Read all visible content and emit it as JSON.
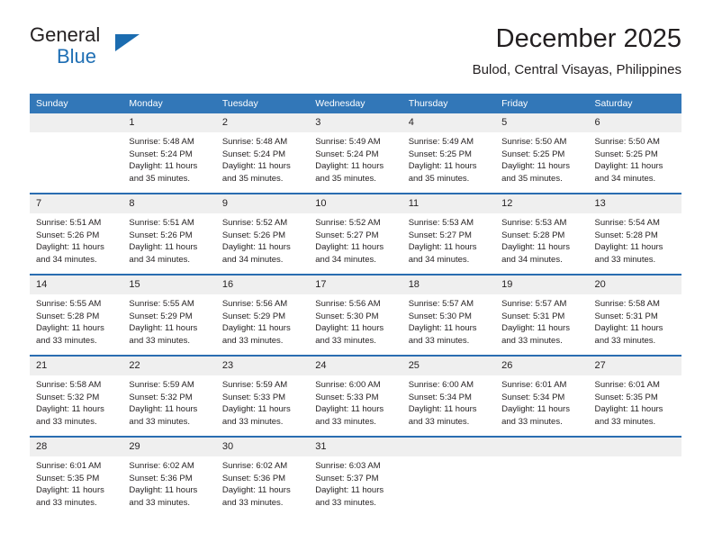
{
  "brand": {
    "name_top": "General",
    "name_bottom": "Blue",
    "accent_color": "#1b6cb0"
  },
  "header": {
    "title": "December 2025",
    "subtitle": "Bulod, Central Visayas, Philippines"
  },
  "calendar": {
    "header_bg": "#3277b8",
    "header_text_color": "#ffffff",
    "daynum_bg": "#efefef",
    "row_divider_color": "#2a6db1",
    "weekday_headers": [
      "Sunday",
      "Monday",
      "Tuesday",
      "Wednesday",
      "Thursday",
      "Friday",
      "Saturday"
    ],
    "weeks": [
      [
        {
          "day": "",
          "sunrise": "",
          "sunset": "",
          "daylight_line1": "",
          "daylight_line2": "",
          "empty": true
        },
        {
          "day": "1",
          "sunrise": "Sunrise: 5:48 AM",
          "sunset": "Sunset: 5:24 PM",
          "daylight_line1": "Daylight: 11 hours",
          "daylight_line2": "and 35 minutes.",
          "empty": false
        },
        {
          "day": "2",
          "sunrise": "Sunrise: 5:48 AM",
          "sunset": "Sunset: 5:24 PM",
          "daylight_line1": "Daylight: 11 hours",
          "daylight_line2": "and 35 minutes.",
          "empty": false
        },
        {
          "day": "3",
          "sunrise": "Sunrise: 5:49 AM",
          "sunset": "Sunset: 5:24 PM",
          "daylight_line1": "Daylight: 11 hours",
          "daylight_line2": "and 35 minutes.",
          "empty": false
        },
        {
          "day": "4",
          "sunrise": "Sunrise: 5:49 AM",
          "sunset": "Sunset: 5:25 PM",
          "daylight_line1": "Daylight: 11 hours",
          "daylight_line2": "and 35 minutes.",
          "empty": false
        },
        {
          "day": "5",
          "sunrise": "Sunrise: 5:50 AM",
          "sunset": "Sunset: 5:25 PM",
          "daylight_line1": "Daylight: 11 hours",
          "daylight_line2": "and 35 minutes.",
          "empty": false
        },
        {
          "day": "6",
          "sunrise": "Sunrise: 5:50 AM",
          "sunset": "Sunset: 5:25 PM",
          "daylight_line1": "Daylight: 11 hours",
          "daylight_line2": "and 34 minutes.",
          "empty": false
        }
      ],
      [
        {
          "day": "7",
          "sunrise": "Sunrise: 5:51 AM",
          "sunset": "Sunset: 5:26 PM",
          "daylight_line1": "Daylight: 11 hours",
          "daylight_line2": "and 34 minutes.",
          "empty": false
        },
        {
          "day": "8",
          "sunrise": "Sunrise: 5:51 AM",
          "sunset": "Sunset: 5:26 PM",
          "daylight_line1": "Daylight: 11 hours",
          "daylight_line2": "and 34 minutes.",
          "empty": false
        },
        {
          "day": "9",
          "sunrise": "Sunrise: 5:52 AM",
          "sunset": "Sunset: 5:26 PM",
          "daylight_line1": "Daylight: 11 hours",
          "daylight_line2": "and 34 minutes.",
          "empty": false
        },
        {
          "day": "10",
          "sunrise": "Sunrise: 5:52 AM",
          "sunset": "Sunset: 5:27 PM",
          "daylight_line1": "Daylight: 11 hours",
          "daylight_line2": "and 34 minutes.",
          "empty": false
        },
        {
          "day": "11",
          "sunrise": "Sunrise: 5:53 AM",
          "sunset": "Sunset: 5:27 PM",
          "daylight_line1": "Daylight: 11 hours",
          "daylight_line2": "and 34 minutes.",
          "empty": false
        },
        {
          "day": "12",
          "sunrise": "Sunrise: 5:53 AM",
          "sunset": "Sunset: 5:28 PM",
          "daylight_line1": "Daylight: 11 hours",
          "daylight_line2": "and 34 minutes.",
          "empty": false
        },
        {
          "day": "13",
          "sunrise": "Sunrise: 5:54 AM",
          "sunset": "Sunset: 5:28 PM",
          "daylight_line1": "Daylight: 11 hours",
          "daylight_line2": "and 33 minutes.",
          "empty": false
        }
      ],
      [
        {
          "day": "14",
          "sunrise": "Sunrise: 5:55 AM",
          "sunset": "Sunset: 5:28 PM",
          "daylight_line1": "Daylight: 11 hours",
          "daylight_line2": "and 33 minutes.",
          "empty": false
        },
        {
          "day": "15",
          "sunrise": "Sunrise: 5:55 AM",
          "sunset": "Sunset: 5:29 PM",
          "daylight_line1": "Daylight: 11 hours",
          "daylight_line2": "and 33 minutes.",
          "empty": false
        },
        {
          "day": "16",
          "sunrise": "Sunrise: 5:56 AM",
          "sunset": "Sunset: 5:29 PM",
          "daylight_line1": "Daylight: 11 hours",
          "daylight_line2": "and 33 minutes.",
          "empty": false
        },
        {
          "day": "17",
          "sunrise": "Sunrise: 5:56 AM",
          "sunset": "Sunset: 5:30 PM",
          "daylight_line1": "Daylight: 11 hours",
          "daylight_line2": "and 33 minutes.",
          "empty": false
        },
        {
          "day": "18",
          "sunrise": "Sunrise: 5:57 AM",
          "sunset": "Sunset: 5:30 PM",
          "daylight_line1": "Daylight: 11 hours",
          "daylight_line2": "and 33 minutes.",
          "empty": false
        },
        {
          "day": "19",
          "sunrise": "Sunrise: 5:57 AM",
          "sunset": "Sunset: 5:31 PM",
          "daylight_line1": "Daylight: 11 hours",
          "daylight_line2": "and 33 minutes.",
          "empty": false
        },
        {
          "day": "20",
          "sunrise": "Sunrise: 5:58 AM",
          "sunset": "Sunset: 5:31 PM",
          "daylight_line1": "Daylight: 11 hours",
          "daylight_line2": "and 33 minutes.",
          "empty": false
        }
      ],
      [
        {
          "day": "21",
          "sunrise": "Sunrise: 5:58 AM",
          "sunset": "Sunset: 5:32 PM",
          "daylight_line1": "Daylight: 11 hours",
          "daylight_line2": "and 33 minutes.",
          "empty": false
        },
        {
          "day": "22",
          "sunrise": "Sunrise: 5:59 AM",
          "sunset": "Sunset: 5:32 PM",
          "daylight_line1": "Daylight: 11 hours",
          "daylight_line2": "and 33 minutes.",
          "empty": false
        },
        {
          "day": "23",
          "sunrise": "Sunrise: 5:59 AM",
          "sunset": "Sunset: 5:33 PM",
          "daylight_line1": "Daylight: 11 hours",
          "daylight_line2": "and 33 minutes.",
          "empty": false
        },
        {
          "day": "24",
          "sunrise": "Sunrise: 6:00 AM",
          "sunset": "Sunset: 5:33 PM",
          "daylight_line1": "Daylight: 11 hours",
          "daylight_line2": "and 33 minutes.",
          "empty": false
        },
        {
          "day": "25",
          "sunrise": "Sunrise: 6:00 AM",
          "sunset": "Sunset: 5:34 PM",
          "daylight_line1": "Daylight: 11 hours",
          "daylight_line2": "and 33 minutes.",
          "empty": false
        },
        {
          "day": "26",
          "sunrise": "Sunrise: 6:01 AM",
          "sunset": "Sunset: 5:34 PM",
          "daylight_line1": "Daylight: 11 hours",
          "daylight_line2": "and 33 minutes.",
          "empty": false
        },
        {
          "day": "27",
          "sunrise": "Sunrise: 6:01 AM",
          "sunset": "Sunset: 5:35 PM",
          "daylight_line1": "Daylight: 11 hours",
          "daylight_line2": "and 33 minutes.",
          "empty": false
        }
      ],
      [
        {
          "day": "28",
          "sunrise": "Sunrise: 6:01 AM",
          "sunset": "Sunset: 5:35 PM",
          "daylight_line1": "Daylight: 11 hours",
          "daylight_line2": "and 33 minutes.",
          "empty": false
        },
        {
          "day": "29",
          "sunrise": "Sunrise: 6:02 AM",
          "sunset": "Sunset: 5:36 PM",
          "daylight_line1": "Daylight: 11 hours",
          "daylight_line2": "and 33 minutes.",
          "empty": false
        },
        {
          "day": "30",
          "sunrise": "Sunrise: 6:02 AM",
          "sunset": "Sunset: 5:36 PM",
          "daylight_line1": "Daylight: 11 hours",
          "daylight_line2": "and 33 minutes.",
          "empty": false
        },
        {
          "day": "31",
          "sunrise": "Sunrise: 6:03 AM",
          "sunset": "Sunset: 5:37 PM",
          "daylight_line1": "Daylight: 11 hours",
          "daylight_line2": "and 33 minutes.",
          "empty": false
        },
        {
          "day": "",
          "sunrise": "",
          "sunset": "",
          "daylight_line1": "",
          "daylight_line2": "",
          "empty": true
        },
        {
          "day": "",
          "sunrise": "",
          "sunset": "",
          "daylight_line1": "",
          "daylight_line2": "",
          "empty": true
        },
        {
          "day": "",
          "sunrise": "",
          "sunset": "",
          "daylight_line1": "",
          "daylight_line2": "",
          "empty": true
        }
      ]
    ]
  }
}
